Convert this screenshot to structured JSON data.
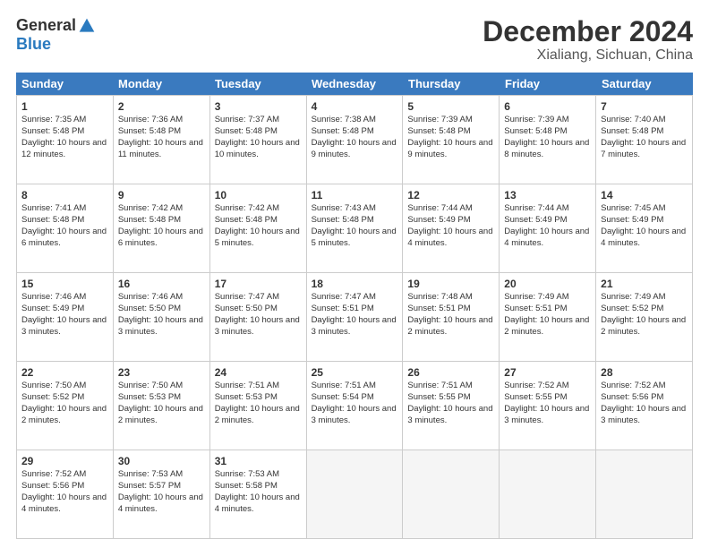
{
  "logo": {
    "general": "General",
    "blue": "Blue"
  },
  "title": "December 2024",
  "location": "Xialiang, Sichuan, China",
  "days_of_week": [
    "Sunday",
    "Monday",
    "Tuesday",
    "Wednesday",
    "Thursday",
    "Friday",
    "Saturday"
  ],
  "weeks": [
    [
      {
        "day": 1,
        "sunrise": "7:35 AM",
        "sunset": "5:48 PM",
        "daylight": "10 hours and 12 minutes."
      },
      {
        "day": 2,
        "sunrise": "7:36 AM",
        "sunset": "5:48 PM",
        "daylight": "10 hours and 11 minutes."
      },
      {
        "day": 3,
        "sunrise": "7:37 AM",
        "sunset": "5:48 PM",
        "daylight": "10 hours and 10 minutes."
      },
      {
        "day": 4,
        "sunrise": "7:38 AM",
        "sunset": "5:48 PM",
        "daylight": "10 hours and 9 minutes."
      },
      {
        "day": 5,
        "sunrise": "7:39 AM",
        "sunset": "5:48 PM",
        "daylight": "10 hours and 9 minutes."
      },
      {
        "day": 6,
        "sunrise": "7:39 AM",
        "sunset": "5:48 PM",
        "daylight": "10 hours and 8 minutes."
      },
      {
        "day": 7,
        "sunrise": "7:40 AM",
        "sunset": "5:48 PM",
        "daylight": "10 hours and 7 minutes."
      }
    ],
    [
      {
        "day": 8,
        "sunrise": "7:41 AM",
        "sunset": "5:48 PM",
        "daylight": "10 hours and 6 minutes."
      },
      {
        "day": 9,
        "sunrise": "7:42 AM",
        "sunset": "5:48 PM",
        "daylight": "10 hours and 6 minutes."
      },
      {
        "day": 10,
        "sunrise": "7:42 AM",
        "sunset": "5:48 PM",
        "daylight": "10 hours and 5 minutes."
      },
      {
        "day": 11,
        "sunrise": "7:43 AM",
        "sunset": "5:48 PM",
        "daylight": "10 hours and 5 minutes."
      },
      {
        "day": 12,
        "sunrise": "7:44 AM",
        "sunset": "5:49 PM",
        "daylight": "10 hours and 4 minutes."
      },
      {
        "day": 13,
        "sunrise": "7:44 AM",
        "sunset": "5:49 PM",
        "daylight": "10 hours and 4 minutes."
      },
      {
        "day": 14,
        "sunrise": "7:45 AM",
        "sunset": "5:49 PM",
        "daylight": "10 hours and 4 minutes."
      }
    ],
    [
      {
        "day": 15,
        "sunrise": "7:46 AM",
        "sunset": "5:49 PM",
        "daylight": "10 hours and 3 minutes."
      },
      {
        "day": 16,
        "sunrise": "7:46 AM",
        "sunset": "5:50 PM",
        "daylight": "10 hours and 3 minutes."
      },
      {
        "day": 17,
        "sunrise": "7:47 AM",
        "sunset": "5:50 PM",
        "daylight": "10 hours and 3 minutes."
      },
      {
        "day": 18,
        "sunrise": "7:47 AM",
        "sunset": "5:51 PM",
        "daylight": "10 hours and 3 minutes."
      },
      {
        "day": 19,
        "sunrise": "7:48 AM",
        "sunset": "5:51 PM",
        "daylight": "10 hours and 2 minutes."
      },
      {
        "day": 20,
        "sunrise": "7:49 AM",
        "sunset": "5:51 PM",
        "daylight": "10 hours and 2 minutes."
      },
      {
        "day": 21,
        "sunrise": "7:49 AM",
        "sunset": "5:52 PM",
        "daylight": "10 hours and 2 minutes."
      }
    ],
    [
      {
        "day": 22,
        "sunrise": "7:50 AM",
        "sunset": "5:52 PM",
        "daylight": "10 hours and 2 minutes."
      },
      {
        "day": 23,
        "sunrise": "7:50 AM",
        "sunset": "5:53 PM",
        "daylight": "10 hours and 2 minutes."
      },
      {
        "day": 24,
        "sunrise": "7:51 AM",
        "sunset": "5:53 PM",
        "daylight": "10 hours and 2 minutes."
      },
      {
        "day": 25,
        "sunrise": "7:51 AM",
        "sunset": "5:54 PM",
        "daylight": "10 hours and 3 minutes."
      },
      {
        "day": 26,
        "sunrise": "7:51 AM",
        "sunset": "5:55 PM",
        "daylight": "10 hours and 3 minutes."
      },
      {
        "day": 27,
        "sunrise": "7:52 AM",
        "sunset": "5:55 PM",
        "daylight": "10 hours and 3 minutes."
      },
      {
        "day": 28,
        "sunrise": "7:52 AM",
        "sunset": "5:56 PM",
        "daylight": "10 hours and 3 minutes."
      }
    ],
    [
      {
        "day": 29,
        "sunrise": "7:52 AM",
        "sunset": "5:56 PM",
        "daylight": "10 hours and 4 minutes."
      },
      {
        "day": 30,
        "sunrise": "7:53 AM",
        "sunset": "5:57 PM",
        "daylight": "10 hours and 4 minutes."
      },
      {
        "day": 31,
        "sunrise": "7:53 AM",
        "sunset": "5:58 PM",
        "daylight": "10 hours and 4 minutes."
      },
      null,
      null,
      null,
      null
    ]
  ]
}
